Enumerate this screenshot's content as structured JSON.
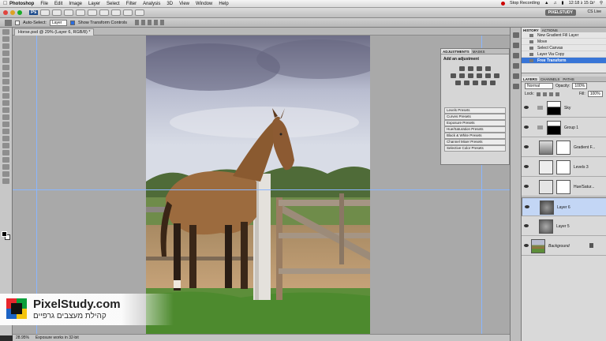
{
  "menubar": {
    "items": [
      "Photoshop",
      "File",
      "Edit",
      "Image",
      "Layer",
      "Select",
      "Filter",
      "Analysis",
      "3D",
      "View",
      "Window",
      "Help"
    ],
    "recording": "Stop Recording",
    "clock": "12:18 יום 15 ג"
  },
  "appbar": {
    "workspace": "PIXELSTUDY",
    "cs_live": "CS Live"
  },
  "options": {
    "auto_select": "Auto-Select:",
    "layer_select": "Layer",
    "show_transform": "Show Transform Controls"
  },
  "document": {
    "tab_title": "Horse.psd @ 29% (Layer 6, RGB/8) *",
    "zoom": "28.95%",
    "status_msg": "Exposure works in 32-bit"
  },
  "adjustments": {
    "tabs": [
      "ADJUSTMENTS",
      "MASKS"
    ],
    "title": "Add an adjustment",
    "presets": [
      "Levels Presets",
      "Curves Presets",
      "Exposure Presets",
      "Hue/Saturation Presets",
      "Black & White Presets",
      "Channel Mixer Presets",
      "Selective Color Presets"
    ]
  },
  "history": {
    "tabs": [
      "HISTORY",
      "ACTIONS"
    ],
    "items": [
      "New Gradient Fill Layer",
      "Move",
      "Select Canvas",
      "Layer Via Copy",
      "Free Transform"
    ]
  },
  "layers": {
    "tabs": [
      "LAYERS",
      "CHANNELS",
      "PATHS"
    ],
    "blend_mode": "Normal",
    "opacity_label": "Opacity:",
    "opacity": "100%",
    "lock_label": "Lock:",
    "fill_label": "Fill:",
    "fill": "100%",
    "items": [
      "Sky",
      "Group 1",
      "Gradient F...",
      "Levels 3",
      "Hue/Satur...",
      "Layer 6",
      "Layer 5",
      "Background"
    ]
  },
  "watermark": {
    "title": "PixelStudy.com",
    "subtitle": "קהילת מעצבים גרפיים"
  }
}
